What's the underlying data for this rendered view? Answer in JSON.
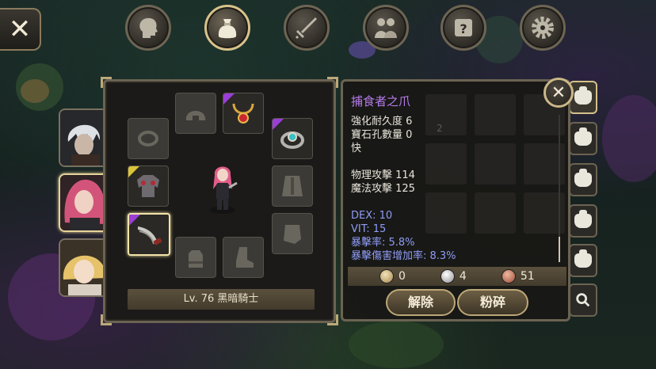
{
  "top_nav": {
    "close_label": "✕",
    "tabs": [
      {
        "icon": "head-icon",
        "active": false
      },
      {
        "icon": "bag-icon",
        "active": true
      },
      {
        "icon": "sword-icon",
        "active": false
      },
      {
        "icon": "party-icon",
        "active": false
      },
      {
        "icon": "quest-scroll-icon",
        "active": false
      },
      {
        "icon": "settings-gear-icon",
        "active": false
      }
    ]
  },
  "equipment": {
    "level_label": "Lv. 76 黑暗騎士"
  },
  "item_info": {
    "name": "捕食者之爪",
    "durability": "強化耐久度 6",
    "sockets": "寶石孔數量 0",
    "speed": "快",
    "phys_attack": "物理攻擊 114",
    "magic_attack": "魔法攻擊 125",
    "dex": "DEX: 10",
    "vit": "VIT: 15",
    "crit_rate": "暴擊率: 5.8%",
    "crit_damage": "暴擊傷害增加率: 8.3%",
    "close_label": "✕",
    "ghost_count": "2"
  },
  "currency": {
    "gold": "0",
    "silver": "4",
    "copper": "51"
  },
  "actions": {
    "unequip_label": "解除",
    "shatter_label": "粉碎"
  },
  "colors": {
    "item_name_purple": "#b57be8",
    "stat_blue": "#8f9cf5",
    "frame_gold": "#bba879",
    "rarity_purple": "#9a3fd6",
    "rarity_yellow": "#d9c43a"
  }
}
